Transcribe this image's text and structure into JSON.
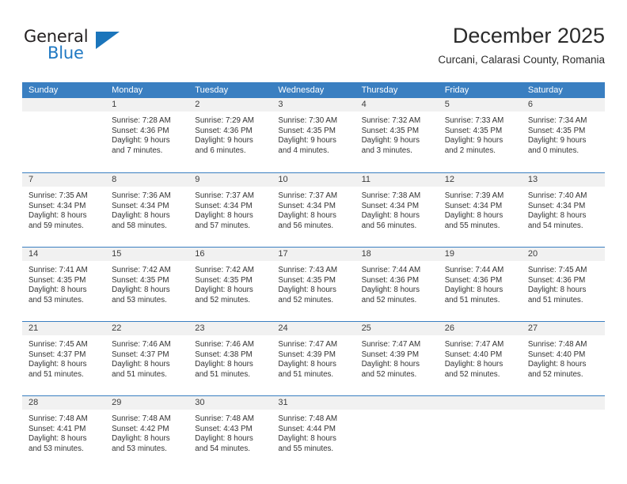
{
  "brand": {
    "name_top": "General",
    "name_bottom": "Blue",
    "accent_color": "#1b75bb",
    "text_color": "#231f20"
  },
  "header": {
    "title": "December 2025",
    "subtitle": "Curcani, Calarasi County, Romania"
  },
  "calendar": {
    "header_bg": "#3a7fc1",
    "daynum_bg": "#f1f1f1",
    "weekdays": [
      "Sunday",
      "Monday",
      "Tuesday",
      "Wednesday",
      "Thursday",
      "Friday",
      "Saturday"
    ],
    "weeks": [
      [
        {
          "day": "",
          "sunrise": "",
          "sunset": "",
          "daylight_line1": "",
          "daylight_line2": ""
        },
        {
          "day": "1",
          "sunrise": "Sunrise: 7:28 AM",
          "sunset": "Sunset: 4:36 PM",
          "daylight_line1": "Daylight: 9 hours",
          "daylight_line2": "and 7 minutes."
        },
        {
          "day": "2",
          "sunrise": "Sunrise: 7:29 AM",
          "sunset": "Sunset: 4:36 PM",
          "daylight_line1": "Daylight: 9 hours",
          "daylight_line2": "and 6 minutes."
        },
        {
          "day": "3",
          "sunrise": "Sunrise: 7:30 AM",
          "sunset": "Sunset: 4:35 PM",
          "daylight_line1": "Daylight: 9 hours",
          "daylight_line2": "and 4 minutes."
        },
        {
          "day": "4",
          "sunrise": "Sunrise: 7:32 AM",
          "sunset": "Sunset: 4:35 PM",
          "daylight_line1": "Daylight: 9 hours",
          "daylight_line2": "and 3 minutes."
        },
        {
          "day": "5",
          "sunrise": "Sunrise: 7:33 AM",
          "sunset": "Sunset: 4:35 PM",
          "daylight_line1": "Daylight: 9 hours",
          "daylight_line2": "and 2 minutes."
        },
        {
          "day": "6",
          "sunrise": "Sunrise: 7:34 AM",
          "sunset": "Sunset: 4:35 PM",
          "daylight_line1": "Daylight: 9 hours",
          "daylight_line2": "and 0 minutes."
        }
      ],
      [
        {
          "day": "7",
          "sunrise": "Sunrise: 7:35 AM",
          "sunset": "Sunset: 4:34 PM",
          "daylight_line1": "Daylight: 8 hours",
          "daylight_line2": "and 59 minutes."
        },
        {
          "day": "8",
          "sunrise": "Sunrise: 7:36 AM",
          "sunset": "Sunset: 4:34 PM",
          "daylight_line1": "Daylight: 8 hours",
          "daylight_line2": "and 58 minutes."
        },
        {
          "day": "9",
          "sunrise": "Sunrise: 7:37 AM",
          "sunset": "Sunset: 4:34 PM",
          "daylight_line1": "Daylight: 8 hours",
          "daylight_line2": "and 57 minutes."
        },
        {
          "day": "10",
          "sunrise": "Sunrise: 7:37 AM",
          "sunset": "Sunset: 4:34 PM",
          "daylight_line1": "Daylight: 8 hours",
          "daylight_line2": "and 56 minutes."
        },
        {
          "day": "11",
          "sunrise": "Sunrise: 7:38 AM",
          "sunset": "Sunset: 4:34 PM",
          "daylight_line1": "Daylight: 8 hours",
          "daylight_line2": "and 56 minutes."
        },
        {
          "day": "12",
          "sunrise": "Sunrise: 7:39 AM",
          "sunset": "Sunset: 4:34 PM",
          "daylight_line1": "Daylight: 8 hours",
          "daylight_line2": "and 55 minutes."
        },
        {
          "day": "13",
          "sunrise": "Sunrise: 7:40 AM",
          "sunset": "Sunset: 4:34 PM",
          "daylight_line1": "Daylight: 8 hours",
          "daylight_line2": "and 54 minutes."
        }
      ],
      [
        {
          "day": "14",
          "sunrise": "Sunrise: 7:41 AM",
          "sunset": "Sunset: 4:35 PM",
          "daylight_line1": "Daylight: 8 hours",
          "daylight_line2": "and 53 minutes."
        },
        {
          "day": "15",
          "sunrise": "Sunrise: 7:42 AM",
          "sunset": "Sunset: 4:35 PM",
          "daylight_line1": "Daylight: 8 hours",
          "daylight_line2": "and 53 minutes."
        },
        {
          "day": "16",
          "sunrise": "Sunrise: 7:42 AM",
          "sunset": "Sunset: 4:35 PM",
          "daylight_line1": "Daylight: 8 hours",
          "daylight_line2": "and 52 minutes."
        },
        {
          "day": "17",
          "sunrise": "Sunrise: 7:43 AM",
          "sunset": "Sunset: 4:35 PM",
          "daylight_line1": "Daylight: 8 hours",
          "daylight_line2": "and 52 minutes."
        },
        {
          "day": "18",
          "sunrise": "Sunrise: 7:44 AM",
          "sunset": "Sunset: 4:36 PM",
          "daylight_line1": "Daylight: 8 hours",
          "daylight_line2": "and 52 minutes."
        },
        {
          "day": "19",
          "sunrise": "Sunrise: 7:44 AM",
          "sunset": "Sunset: 4:36 PM",
          "daylight_line1": "Daylight: 8 hours",
          "daylight_line2": "and 51 minutes."
        },
        {
          "day": "20",
          "sunrise": "Sunrise: 7:45 AM",
          "sunset": "Sunset: 4:36 PM",
          "daylight_line1": "Daylight: 8 hours",
          "daylight_line2": "and 51 minutes."
        }
      ],
      [
        {
          "day": "21",
          "sunrise": "Sunrise: 7:45 AM",
          "sunset": "Sunset: 4:37 PM",
          "daylight_line1": "Daylight: 8 hours",
          "daylight_line2": "and 51 minutes."
        },
        {
          "day": "22",
          "sunrise": "Sunrise: 7:46 AM",
          "sunset": "Sunset: 4:37 PM",
          "daylight_line1": "Daylight: 8 hours",
          "daylight_line2": "and 51 minutes."
        },
        {
          "day": "23",
          "sunrise": "Sunrise: 7:46 AM",
          "sunset": "Sunset: 4:38 PM",
          "daylight_line1": "Daylight: 8 hours",
          "daylight_line2": "and 51 minutes."
        },
        {
          "day": "24",
          "sunrise": "Sunrise: 7:47 AM",
          "sunset": "Sunset: 4:39 PM",
          "daylight_line1": "Daylight: 8 hours",
          "daylight_line2": "and 51 minutes."
        },
        {
          "day": "25",
          "sunrise": "Sunrise: 7:47 AM",
          "sunset": "Sunset: 4:39 PM",
          "daylight_line1": "Daylight: 8 hours",
          "daylight_line2": "and 52 minutes."
        },
        {
          "day": "26",
          "sunrise": "Sunrise: 7:47 AM",
          "sunset": "Sunset: 4:40 PM",
          "daylight_line1": "Daylight: 8 hours",
          "daylight_line2": "and 52 minutes."
        },
        {
          "day": "27",
          "sunrise": "Sunrise: 7:48 AM",
          "sunset": "Sunset: 4:40 PM",
          "daylight_line1": "Daylight: 8 hours",
          "daylight_line2": "and 52 minutes."
        }
      ],
      [
        {
          "day": "28",
          "sunrise": "Sunrise: 7:48 AM",
          "sunset": "Sunset: 4:41 PM",
          "daylight_line1": "Daylight: 8 hours",
          "daylight_line2": "and 53 minutes."
        },
        {
          "day": "29",
          "sunrise": "Sunrise: 7:48 AM",
          "sunset": "Sunset: 4:42 PM",
          "daylight_line1": "Daylight: 8 hours",
          "daylight_line2": "and 53 minutes."
        },
        {
          "day": "30",
          "sunrise": "Sunrise: 7:48 AM",
          "sunset": "Sunset: 4:43 PM",
          "daylight_line1": "Daylight: 8 hours",
          "daylight_line2": "and 54 minutes."
        },
        {
          "day": "31",
          "sunrise": "Sunrise: 7:48 AM",
          "sunset": "Sunset: 4:44 PM",
          "daylight_line1": "Daylight: 8 hours",
          "daylight_line2": "and 55 minutes."
        },
        {
          "day": "",
          "sunrise": "",
          "sunset": "",
          "daylight_line1": "",
          "daylight_line2": ""
        },
        {
          "day": "",
          "sunrise": "",
          "sunset": "",
          "daylight_line1": "",
          "daylight_line2": ""
        },
        {
          "day": "",
          "sunrise": "",
          "sunset": "",
          "daylight_line1": "",
          "daylight_line2": ""
        }
      ]
    ]
  }
}
